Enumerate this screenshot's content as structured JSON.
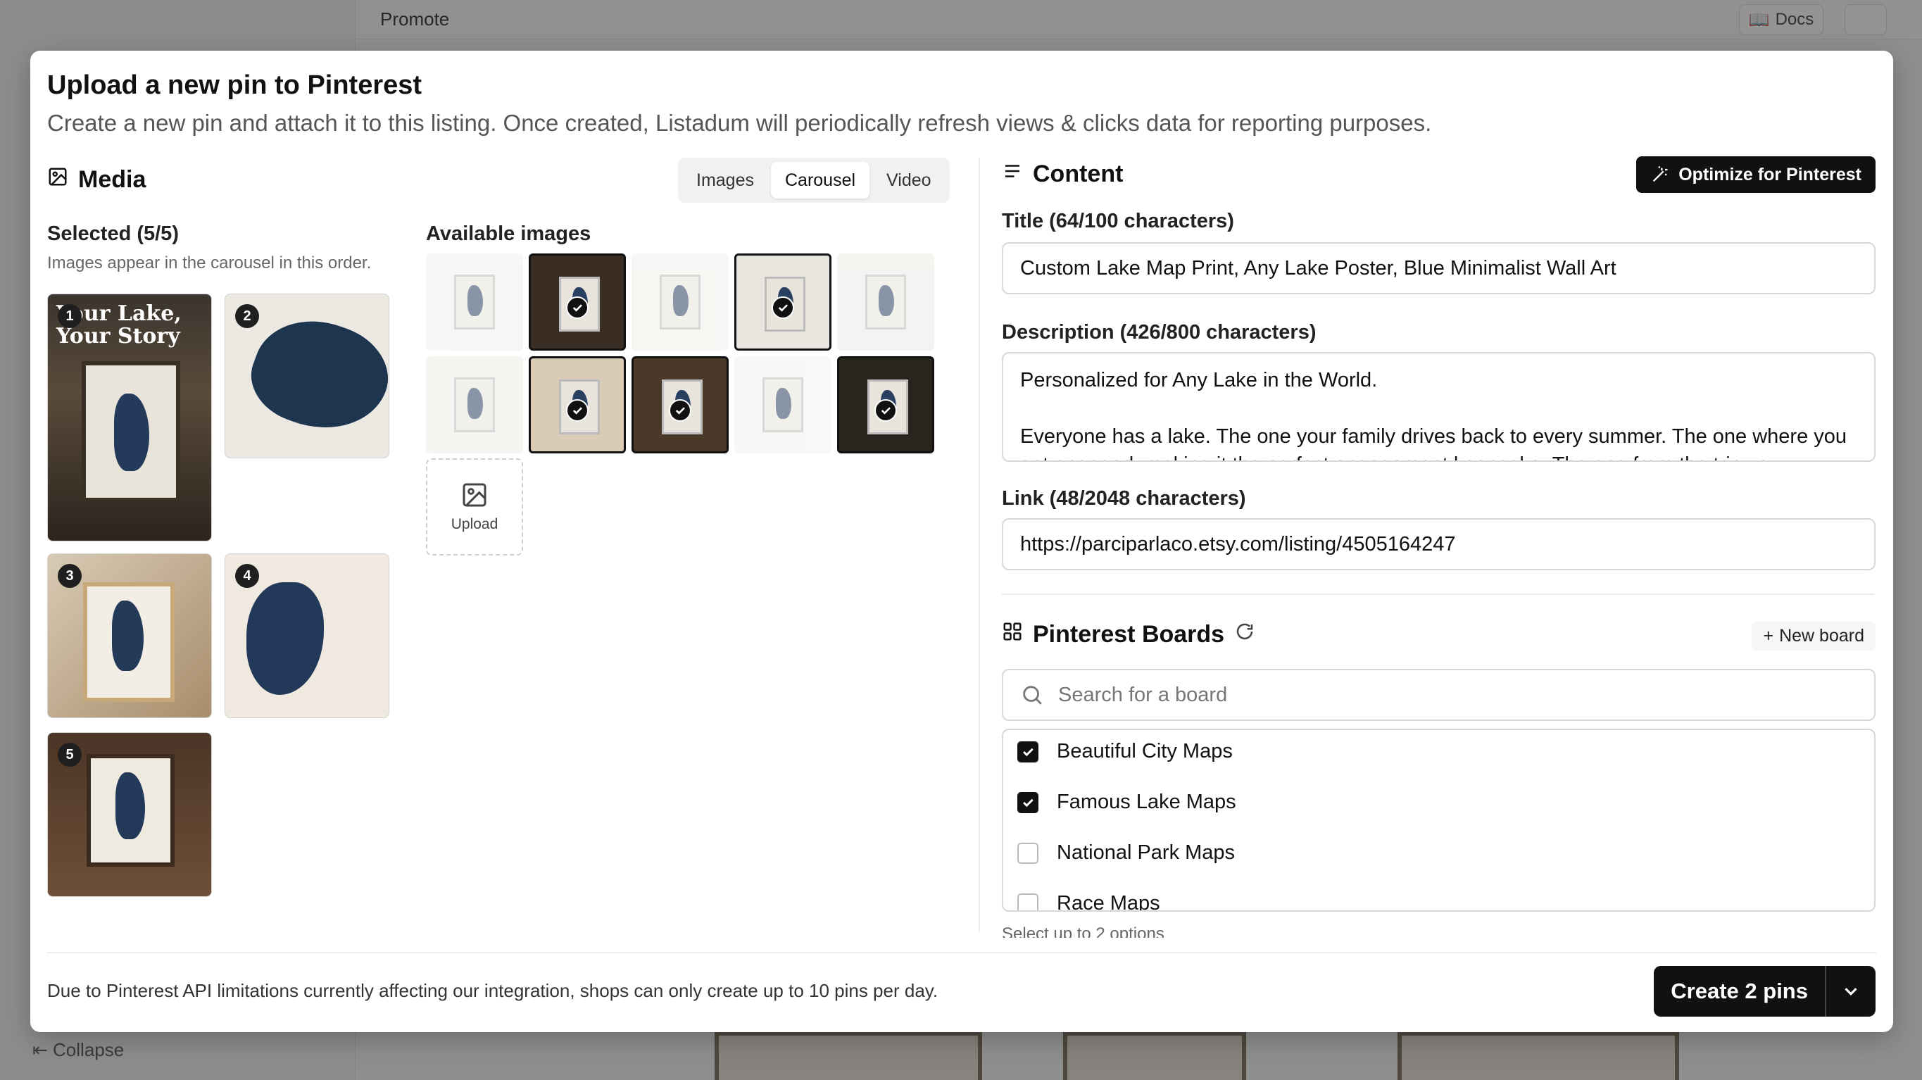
{
  "background": {
    "page_title": "Promote",
    "docs_label": "Docs",
    "collapse_label": "Collapse"
  },
  "modal": {
    "title": "Upload a new pin to Pinterest",
    "subtitle": "Create a new pin and attach it to this listing. Once created, Listadum will periodically refresh views & clicks data for reporting purposes."
  },
  "media": {
    "heading": "Media",
    "tabs": [
      {
        "label": "Images",
        "active": false
      },
      {
        "label": "Carousel",
        "active": true
      },
      {
        "label": "Video",
        "active": false
      }
    ],
    "selected_label": "Selected (5/5)",
    "selected_hint": "Images appear in the carousel in this order.",
    "selected": [
      {
        "order": "1",
        "overlay_text": "Your Lake, Your Story"
      },
      {
        "order": "2"
      },
      {
        "order": "3"
      },
      {
        "order": "4"
      },
      {
        "order": "5"
      }
    ],
    "available_label": "Available images",
    "available": [
      {
        "selected": false
      },
      {
        "selected": true
      },
      {
        "selected": false
      },
      {
        "selected": true
      },
      {
        "selected": false
      },
      {
        "selected": false
      },
      {
        "selected": true
      },
      {
        "selected": true
      },
      {
        "selected": false
      },
      {
        "selected": true
      }
    ],
    "upload_label": "Upload"
  },
  "content": {
    "heading": "Content",
    "optimize_label": "Optimize for Pinterest",
    "title_label": "Title (64/100 characters)",
    "title_value": "Custom Lake Map Print, Any Lake Poster, Blue Minimalist Wall Art",
    "description_label": "Description (426/800 characters)",
    "description_value": "Personalized for Any Lake in the World.\n\nEveryone has a lake. The one your family drives back to every summer. The one where you got engaged, making it the perfect engagement keepsake. The one from the trip you",
    "link_label": "Link (48/2048 characters)",
    "link_value": "https://parciparlaco.etsy.com/listing/4505164247"
  },
  "boards": {
    "heading": "Pinterest Boards",
    "new_board_label": "New board",
    "search_placeholder": "Search for a board",
    "items": [
      {
        "label": "Beautiful City Maps",
        "checked": true
      },
      {
        "label": "Famous Lake Maps",
        "checked": true
      },
      {
        "label": "National Park Maps",
        "checked": false
      },
      {
        "label": "Race Maps",
        "checked": false
      }
    ],
    "hint": "Select up to 2 options"
  },
  "footer": {
    "note": "Due to Pinterest API limitations currently affecting our integration, shops can only create up to 10 pins per day.",
    "create_label": "Create 2 pins"
  }
}
